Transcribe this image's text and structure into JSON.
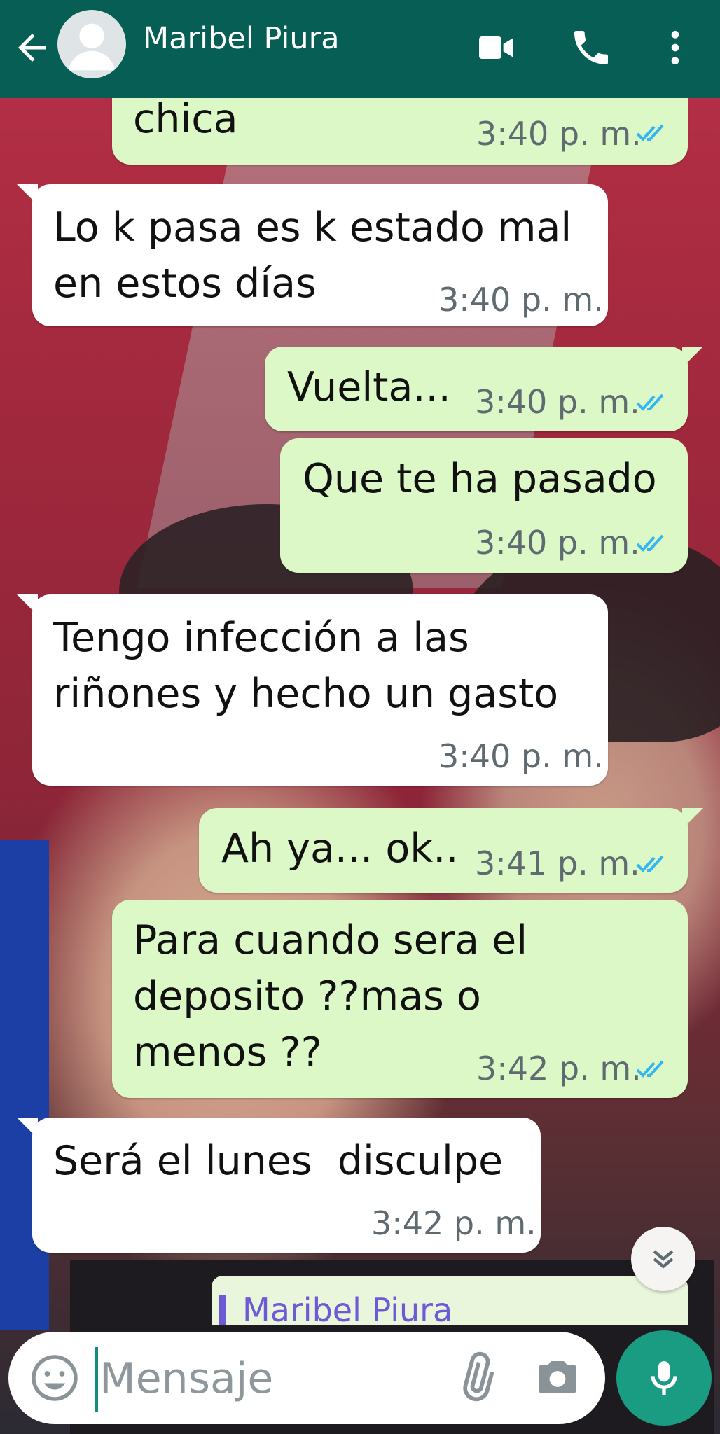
{
  "header": {
    "contact_name": "Maribel Piura",
    "bg_color": "#075e54",
    "icons": [
      "back-arrow-icon",
      "avatar-icon",
      "video-call-icon",
      "phone-icon",
      "more-vert-icon"
    ]
  },
  "messages": [
    {
      "direction": "out",
      "text": "chica",
      "time": "3:40 p. m.",
      "status": "read"
    },
    {
      "direction": "in",
      "lines": [
        "Lo k pasa es k estado mal",
        "en estos días"
      ],
      "time": "3:40 p. m."
    },
    {
      "direction": "out",
      "text": "Vuelta...",
      "time": "3:40 p. m.",
      "status": "read"
    },
    {
      "direction": "out",
      "text": "Que te ha pasado",
      "time": "3:40 p. m.",
      "status": "read"
    },
    {
      "direction": "in",
      "lines": [
        "Tengo infección a las",
        "riñones y hecho un gasto"
      ],
      "time": "3:40 p. m."
    },
    {
      "direction": "out",
      "text": "Ah ya... ok..",
      "time": "3:41 p. m.",
      "status": "read"
    },
    {
      "direction": "out",
      "lines": [
        "Para cuando sera el",
        "deposito ??mas o",
        "menos ??"
      ],
      "time": "3:42 p. m.",
      "status": "read"
    },
    {
      "direction": "in",
      "text": "Será el lunes  disculpe",
      "time": "3:42 p. m."
    }
  ],
  "reply_preview": {
    "name": "Maribel Piura"
  },
  "composer": {
    "placeholder": "Mensaje",
    "icons": [
      "emoji-icon",
      "attach-icon",
      "camera-icon",
      "mic-icon"
    ]
  },
  "colors": {
    "outgoing_bubble": "#dcf8c6",
    "incoming_bubble": "#ffffff",
    "read_tick": "#34b7f1",
    "mic_button": "#1a9c82"
  }
}
